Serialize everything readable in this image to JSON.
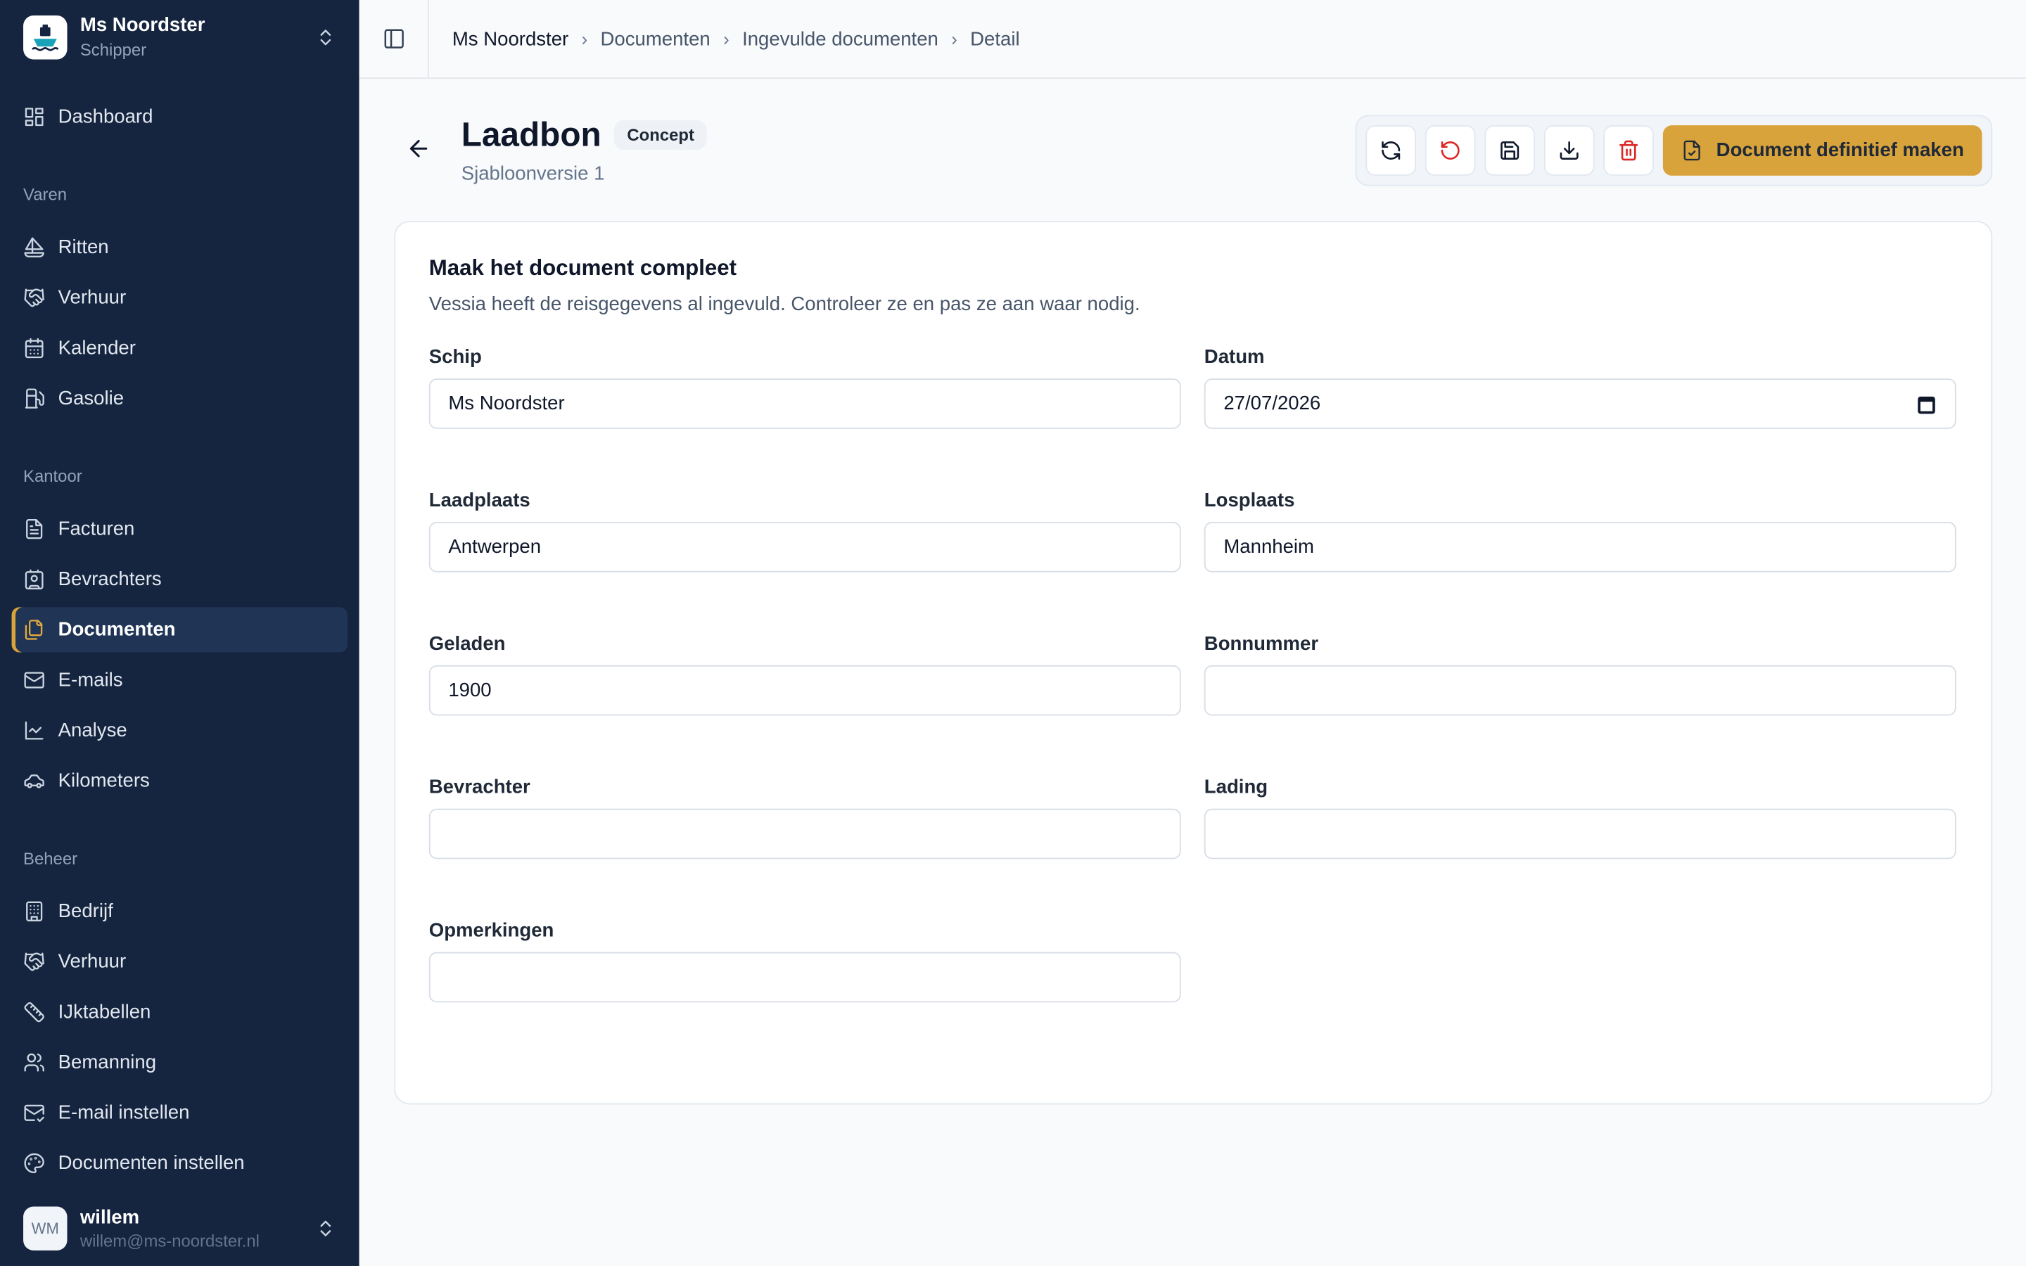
{
  "org": {
    "name": "Ms Noordster",
    "role": "Schipper"
  },
  "nav": {
    "dashboard": "Dashboard",
    "section_varen": "Varen",
    "ritten": "Ritten",
    "verhuur": "Verhuur",
    "kalender": "Kalender",
    "gasolie": "Gasolie",
    "section_kantoor": "Kantoor",
    "facturen": "Facturen",
    "bevrachters": "Bevrachters",
    "documenten": "Documenten",
    "emails": "E-mails",
    "analyse": "Analyse",
    "kilometers": "Kilometers",
    "section_beheer": "Beheer",
    "bedrijf": "Bedrijf",
    "verhuur_beheer": "Verhuur",
    "ijktabellen": "IJktabellen",
    "bemanning": "Bemanning",
    "email_instellen": "E-mail instellen",
    "documenten_instellen": "Documenten instellen"
  },
  "user": {
    "initials": "WM",
    "name": "willem",
    "email": "willem@ms-noordster.nl"
  },
  "breadcrumb": [
    "Ms Noordster",
    "Documenten",
    "Ingevulde documenten",
    "Detail"
  ],
  "header": {
    "title": "Laadbon",
    "badge": "Concept",
    "subtitle": "Sjabloonversie 1",
    "primary_label": "Document definitief maken"
  },
  "colors": {
    "sidebar": "#15243f",
    "accent": "#d9a33b",
    "danger": "#dc2626"
  },
  "form": {
    "title": "Maak het document compleet",
    "description": "Vessia heeft de reisgegevens al ingevuld. Controleer ze en pas ze aan waar nodig.",
    "schip": {
      "label": "Schip",
      "value": "Ms Noordster"
    },
    "datum": {
      "label": "Datum",
      "value": "27/07/2026"
    },
    "laadplaats": {
      "label": "Laadplaats",
      "value": "Antwerpen"
    },
    "losplaats": {
      "label": "Losplaats",
      "value": "Mannheim"
    },
    "geladen": {
      "label": "Geladen",
      "value": "1900"
    },
    "bonnummer": {
      "label": "Bonnummer",
      "value": ""
    },
    "bevrachter": {
      "label": "Bevrachter",
      "value": ""
    },
    "lading": {
      "label": "Lading",
      "value": ""
    },
    "opmerkingen": {
      "label": "Opmerkingen",
      "value": ""
    }
  }
}
